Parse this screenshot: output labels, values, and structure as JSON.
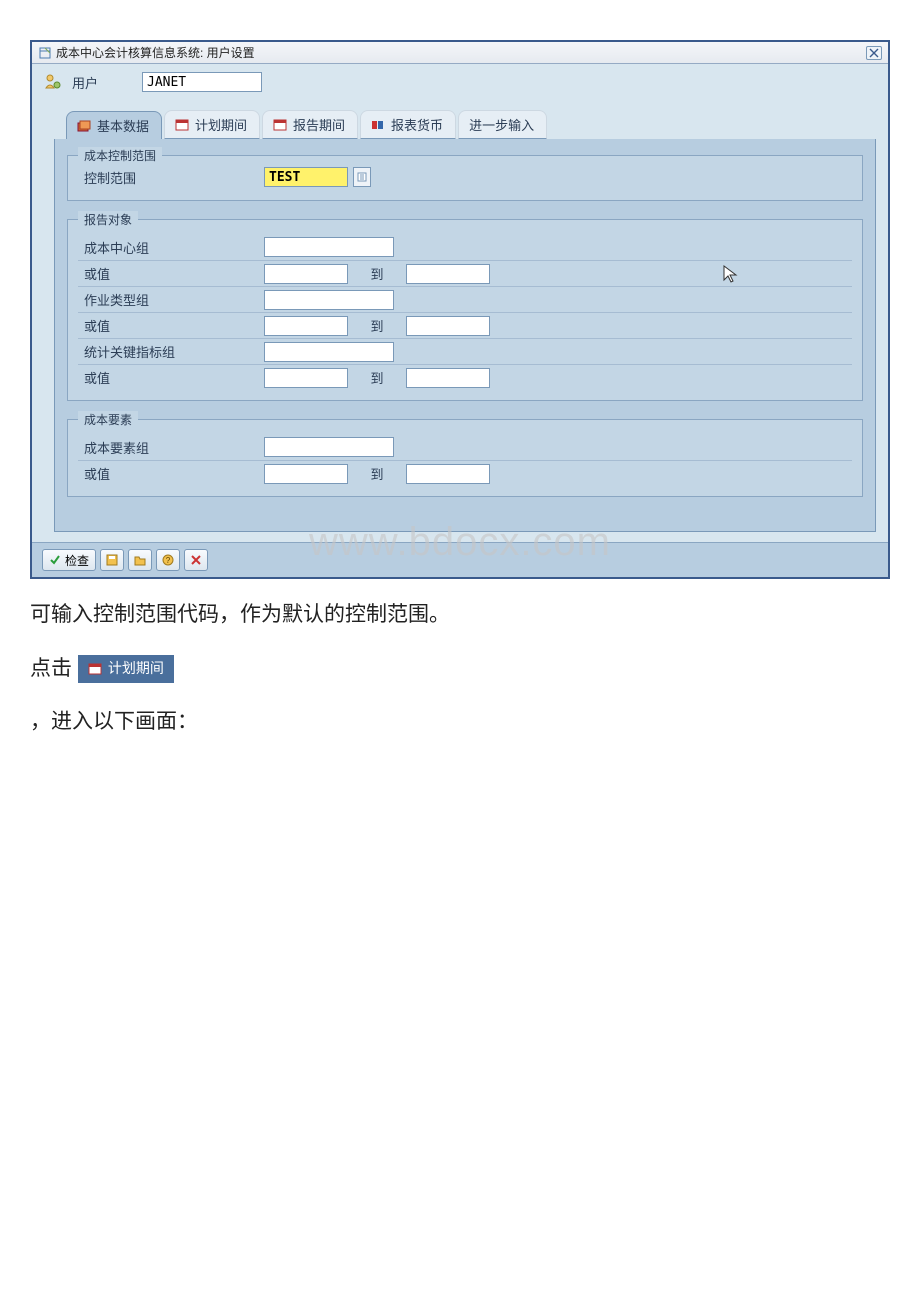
{
  "window": {
    "title": "成本中心会计核算信息系统: 用户设置"
  },
  "user": {
    "label": "用户",
    "value": "JANET"
  },
  "tabs": [
    {
      "label": "基本数据"
    },
    {
      "label": "计划期间"
    },
    {
      "label": "报告期间"
    },
    {
      "label": "报表货币"
    },
    {
      "label": "进一步输入"
    }
  ],
  "groups": {
    "control": {
      "title": "成本控制范围",
      "field_label": "控制范围",
      "value": "TEST"
    },
    "report_obj": {
      "title": "报告对象",
      "rows": [
        {
          "label": "成本中心组",
          "to": ""
        },
        {
          "label": "或值",
          "to": "到"
        },
        {
          "label": "作业类型组",
          "to": ""
        },
        {
          "label": "或值",
          "to": "到"
        },
        {
          "label": "统计关键指标组",
          "to": ""
        },
        {
          "label": "或值",
          "to": "到"
        }
      ]
    },
    "cost_elem": {
      "title": "成本要素",
      "rows": [
        {
          "label": "成本要素组",
          "to": ""
        },
        {
          "label": "或值",
          "to": "到"
        }
      ]
    }
  },
  "buttons": {
    "check": "检查"
  },
  "watermark": "www.bdocx.com",
  "doc": {
    "line1": "可输入控制范围代码，作为默认的控制范围。",
    "line2_prefix": "点击",
    "line2_tab": "计划期间",
    "line3": "，进入以下画面："
  }
}
